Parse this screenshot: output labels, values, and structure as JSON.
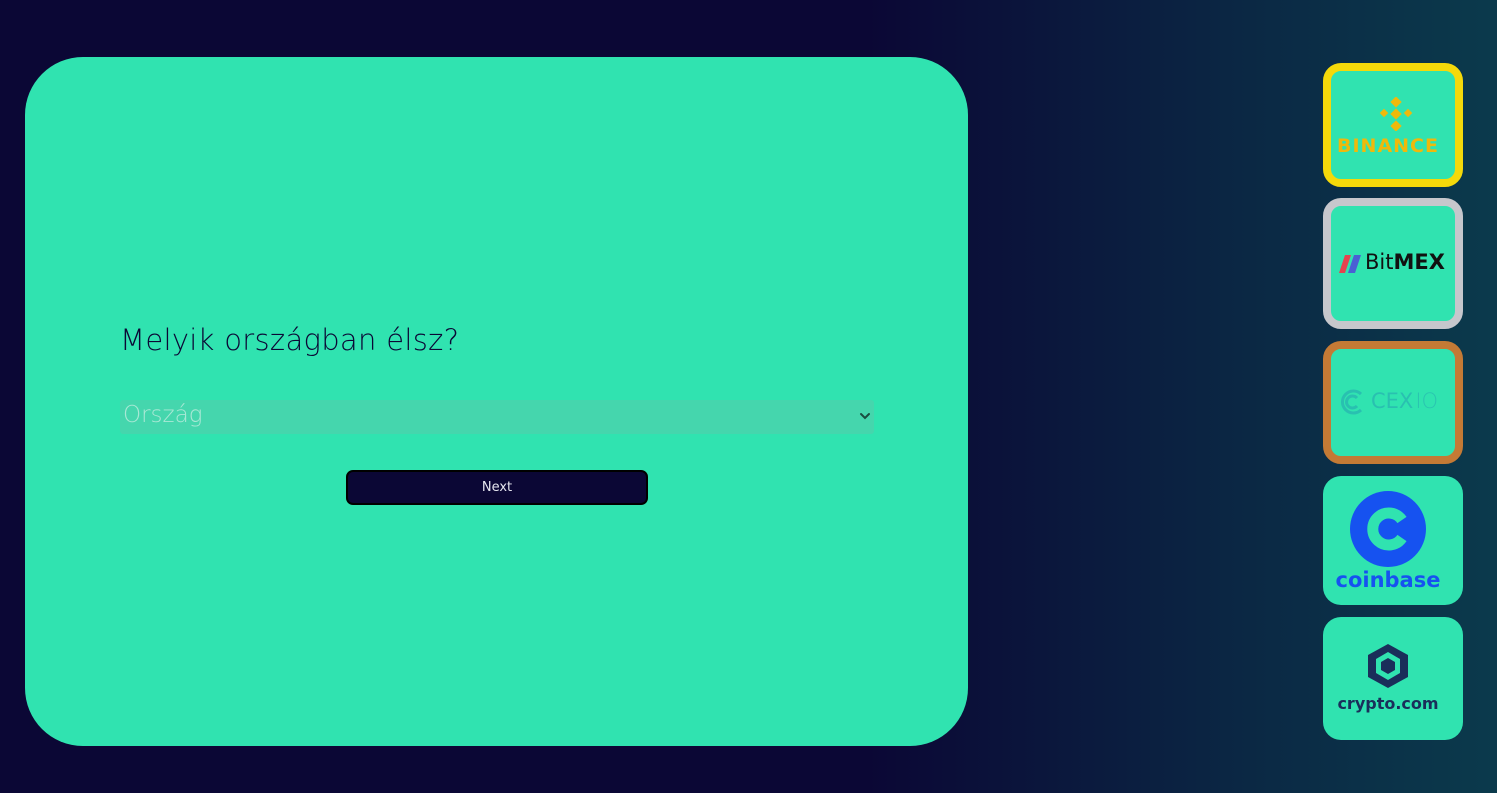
{
  "form": {
    "question": "Melyik országban élsz?",
    "country_select": {
      "selected": "Ország"
    },
    "next_label": "Next"
  },
  "exchanges": [
    {
      "name": "BINANCE",
      "border_color": "#f5d90a",
      "text_color": "#f0b90b"
    },
    {
      "name_part1": "Bit",
      "name_part2": "MEX",
      "border_color": "#c6c7cc"
    },
    {
      "name_part1": "CEX",
      "name_part2": "IO",
      "border_color": "#c47a35",
      "text_color": "#29c0b0"
    },
    {
      "name": "coinbase",
      "text_color": "#1652f0"
    },
    {
      "name": "crypto.com",
      "text_color": "#1a2e5a"
    }
  ],
  "colors": {
    "background": "#0b0735",
    "card": "#30e3b0",
    "button": "#0b0735"
  }
}
